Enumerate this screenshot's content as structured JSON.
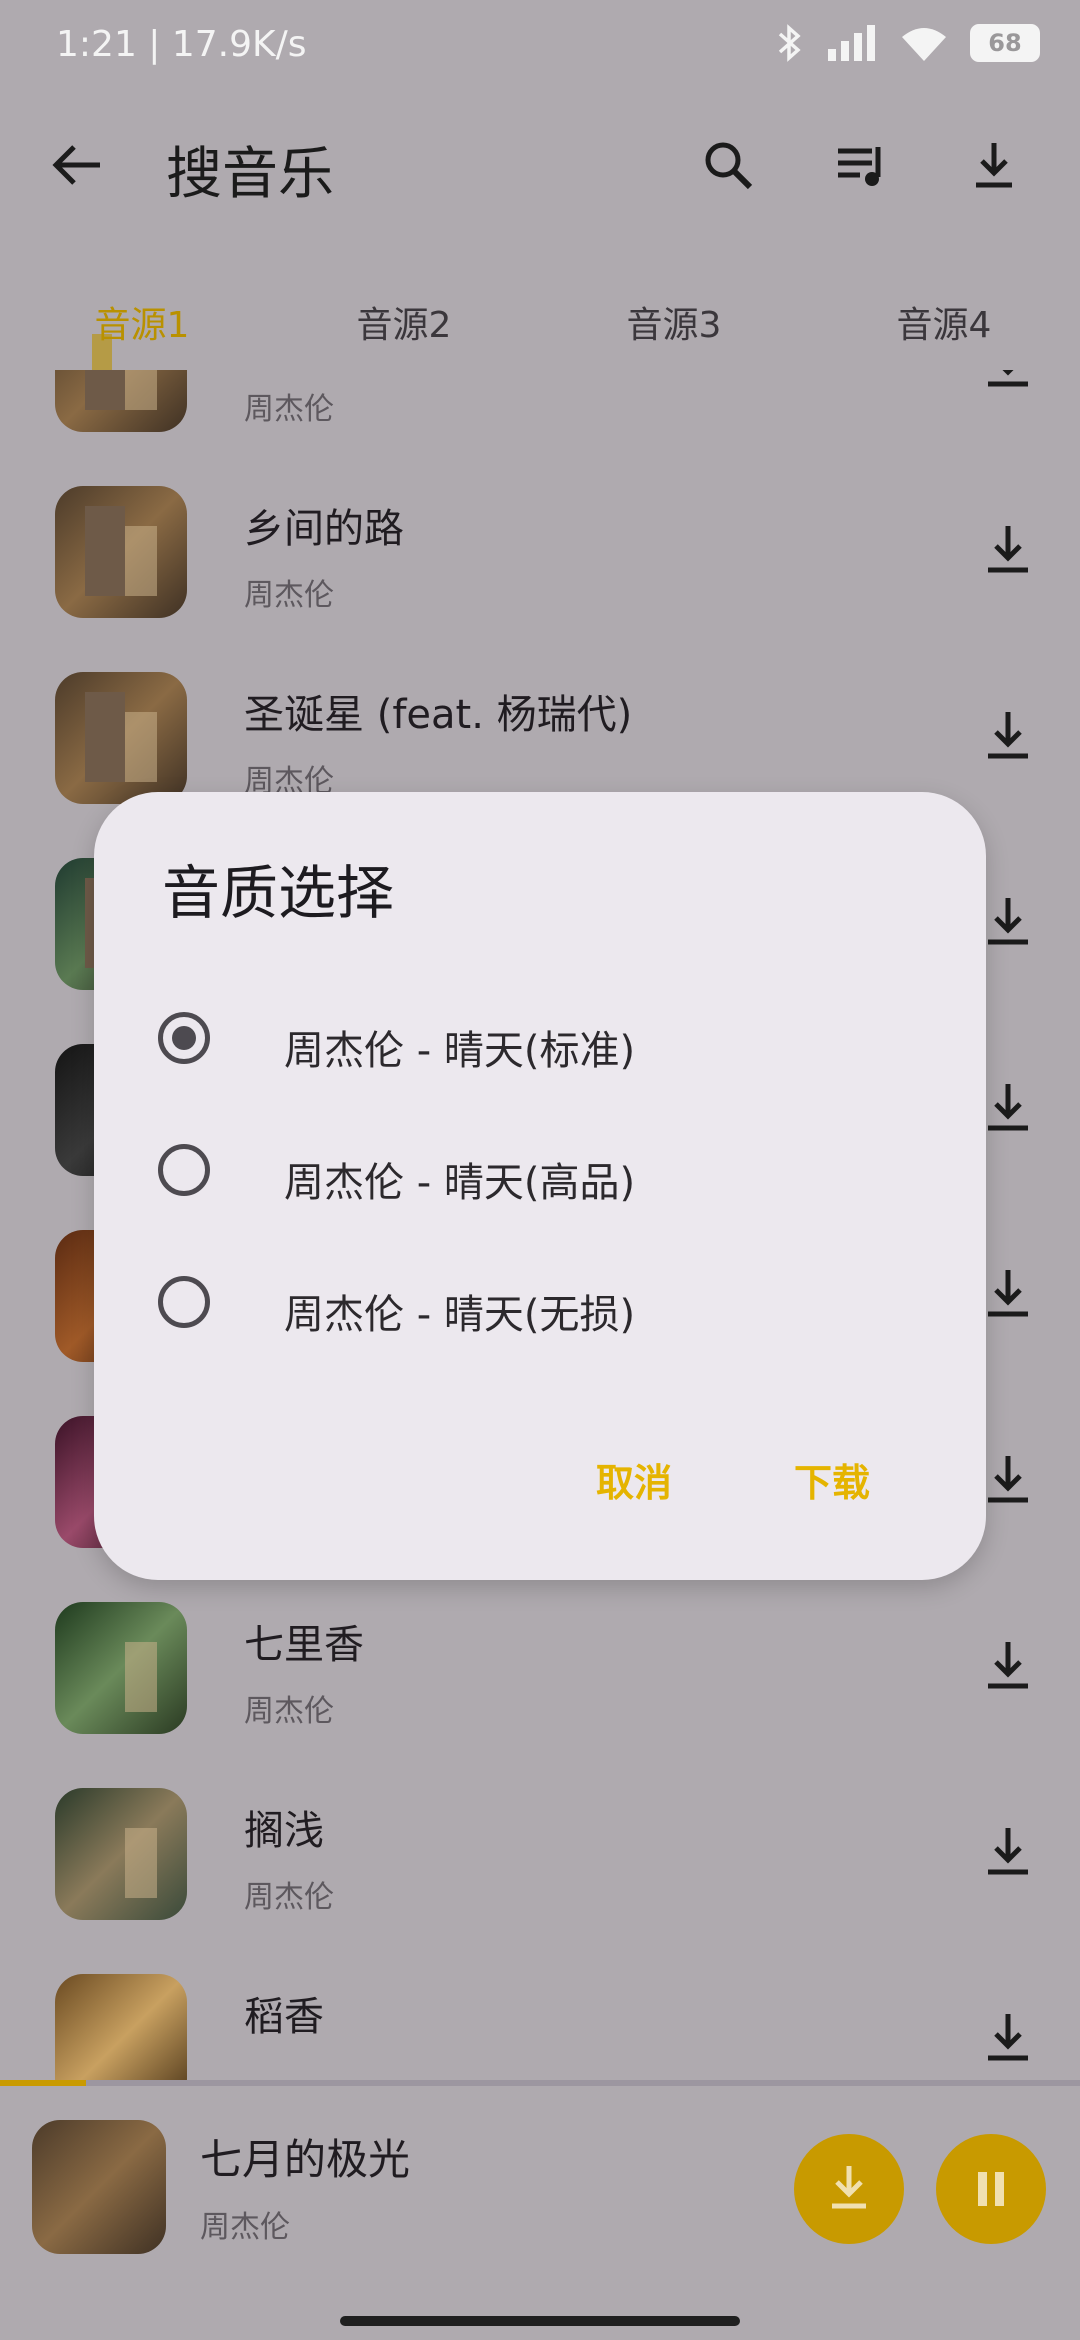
{
  "status_bar": {
    "time": "1:21 | 17.9K/s",
    "battery": "68"
  },
  "app_bar": {
    "title": "搜音乐"
  },
  "tabs": [
    {
      "label": "音源1",
      "active": true
    },
    {
      "label": "音源2",
      "active": false
    },
    {
      "label": "音源3",
      "active": false
    },
    {
      "label": "音源4",
      "active": false
    }
  ],
  "songs": [
    {
      "title": "",
      "artist": "周杰伦"
    },
    {
      "title": "乡间的路",
      "artist": "周杰伦"
    },
    {
      "title": "圣诞星 (feat. 杨瑞代)",
      "artist": "周杰伦"
    },
    {
      "title": "",
      "artist": ""
    },
    {
      "title": "",
      "artist": ""
    },
    {
      "title": "",
      "artist": ""
    },
    {
      "title": "",
      "artist": ""
    },
    {
      "title": "七里香",
      "artist": "周杰伦"
    },
    {
      "title": "搁浅",
      "artist": "周杰伦"
    },
    {
      "title": "稻香",
      "artist": ""
    }
  ],
  "dialog": {
    "title": "音质选择",
    "options": [
      {
        "label": "周杰伦 - 晴天(标准)",
        "selected": true
      },
      {
        "label": "周杰伦 - 晴天(高品)",
        "selected": false
      },
      {
        "label": "周杰伦 - 晴天(无损)",
        "selected": false
      }
    ],
    "cancel": "取消",
    "confirm": "下载"
  },
  "player": {
    "title": "七月的极光",
    "artist": "周杰伦",
    "progress": 0.08
  },
  "colors": {
    "accent": "#e5b400",
    "fab": "#c89a00",
    "scrim": "#afaaaf",
    "dialog": "#ece8ee"
  }
}
